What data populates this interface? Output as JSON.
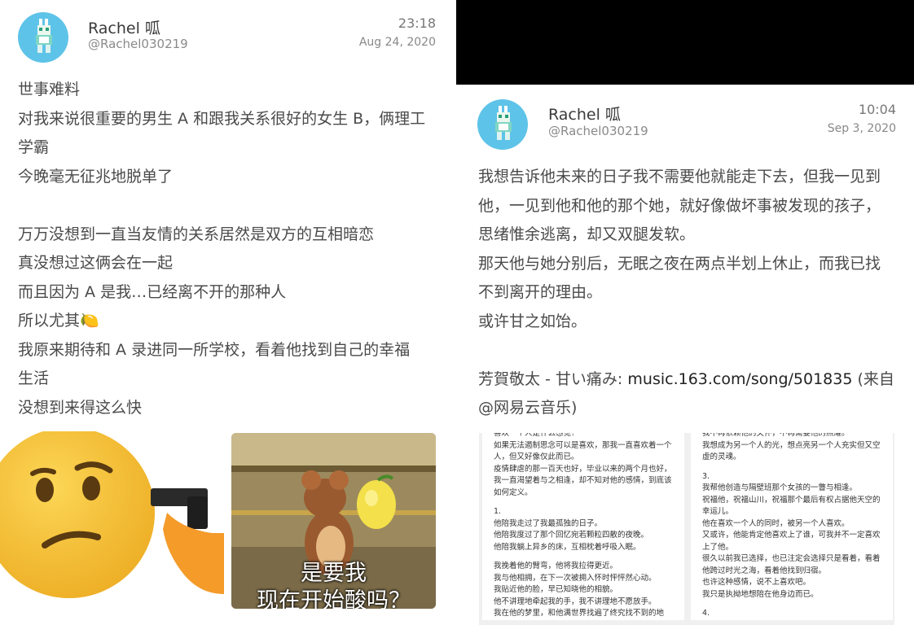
{
  "post1": {
    "user": {
      "name": "Rachel 呱",
      "handle": "@Rachel030219"
    },
    "time": "23:18",
    "date": "Aug 24, 2020",
    "lines": [
      "世事难料",
      "对我来说很重要的男生 A 和跟我关系很好的女生 B，俩理工",
      "学霸",
      "今晚毫无征兆地脱单了",
      "",
      "万万没想到一直当友情的关系居然是双方的互相暗恋",
      "真没想过这俩会在一起",
      "而且因为 A 是我…已经离不开的那种人",
      "所以尤其🍋",
      "我原来期待和 A 录进同一所学校，看着他找到自己的幸福",
      "生活",
      "没想到来得这么快"
    ],
    "meme_caption": [
      "是要我",
      "现在开始酸吗？"
    ]
  },
  "post2": {
    "user": {
      "name": "Rachel 呱",
      "handle": "@Rachel030219"
    },
    "time": "10:04",
    "date": "Sep 3, 2020",
    "lines": [
      "我想告诉他未来的日子我不需要他就能走下去，但我一见到",
      "他，一见到他和他的那个她，就好像做坏事被发现的孩子，",
      "思绪惟余逃离，却又双腿发软。",
      "那天他与她分别后，无眠之夜在两点半划上休止，而我已找",
      "不到离开的理由。",
      "或许甘之如饴。",
      ""
    ],
    "share": {
      "prefix": "芳賀敬太 - 甘い痛み: ",
      "link": "music.163.com/song/501835",
      "suffix_line1": " (来自",
      "line2": "@网易云音乐)"
    },
    "doc_left": [
      "喜欢一个人是什么感觉？",
      "如果无法遏制思念可以是喜欢，那我一直喜欢着一个",
      "人，但又好像仅此而已。",
      "疫情肆虐的那一百天也好，毕业以来的两个月也好，",
      "我一直渴望着与之相逢，却不知对他的感情，到底该",
      "如何定义。",
      "",
      "1.",
      "他陪我走过了我最孤独的日子。",
      "他陪我度过了那个回忆宛若颗粒四散的夜晚。",
      "他陪我躺上异乡的床，互相枕着呼吸入眠。",
      "",
      "我挽着他的臂弯，他将我拉得更近。",
      "我与他相拥，在下一次被拥入怀时怦怦然心动。",
      "我贴近他的脸，早已知晓他的相貌。",
      "他不讲理地牵起我的手，我不讲理地不愿放手。",
      "我在他的梦里，和他满世界找遍了终究找不到的地"
    ],
    "doc_right": [
      "我不再依赖他的关怀，不再需要他的照耀。",
      "我想成为另一个人的光，想点亮另一个人充实但又空",
      "虚的灵魂。",
      "",
      "3.",
      "我帮他创造与隔壁班那个女孩的一瞥与相逢。",
      "祝福他，祝福山川，祝福那个最后有权占据他天空的",
      "幸运儿。",
      "他在喜欢一个人的同时，被另一个人喜欢。",
      "又或许，他能肯定他喜欢上了谁，可我并不一定喜欢",
      "上了他。",
      "很久以前我已选择，也已注定会选择只是看着，看着",
      "他跨过时光之海，看着他找到归宿。",
      "也许这种感情，说不上喜欢吧。",
      "我只是执拗地想陪在他身边而已。",
      "",
      "4."
    ]
  },
  "colors": {
    "avatar_bg": "#5ec3e8",
    "black_band": "#000000"
  }
}
